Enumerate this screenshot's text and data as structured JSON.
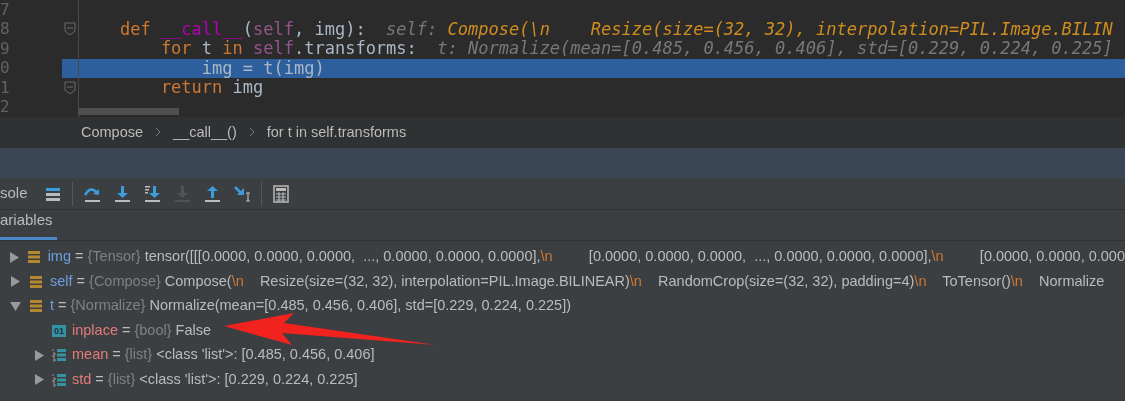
{
  "editor": {
    "lines": [
      {
        "number": "7",
        "current": false,
        "fold": false
      },
      {
        "number": "8",
        "current": false,
        "fold": true,
        "segments": [
          {
            "kind": "keyword",
            "text": "    def "
          },
          {
            "kind": "function",
            "text": "__call__"
          },
          {
            "kind": "plain",
            "text": "("
          },
          {
            "kind": "self",
            "text": "self"
          },
          {
            "kind": "plain",
            "text": ", img):  "
          },
          {
            "kind": "hint",
            "text": "self: "
          },
          {
            "kind": "hint_value",
            "text": "Compose(\\n    Resize(size=(32, 32), interpolation=PIL.Image.BILIN"
          }
        ]
      },
      {
        "number": "9",
        "current": false,
        "fold": false,
        "segments": [
          {
            "kind": "keyword",
            "text": "        for "
          },
          {
            "kind": "plain",
            "text": "t "
          },
          {
            "kind": "keyword",
            "text": "in "
          },
          {
            "kind": "self",
            "text": "self"
          },
          {
            "kind": "plain",
            "text": ".transforms:  "
          },
          {
            "kind": "hint",
            "text": "t: Normalize(mean=[0.485, 0.456, 0.406], std=[0.229, 0.224, 0.225]"
          }
        ]
      },
      {
        "number": "0",
        "current": true,
        "fold": false,
        "segments": [
          {
            "kind": "plain",
            "text": "            img = t(img)"
          }
        ]
      },
      {
        "number": "1",
        "current": false,
        "fold": true,
        "segments": [
          {
            "kind": "keyword",
            "text": "        return "
          },
          {
            "kind": "plain",
            "text": "img"
          }
        ]
      },
      {
        "number": "2",
        "current": false,
        "fold": false
      }
    ]
  },
  "breadcrumbs": [
    "Compose",
    "__call__()",
    "for t in self.transforms"
  ],
  "toolbar": {
    "label": "sole",
    "tools": [
      {
        "kind": "layout",
        "disabled": false
      },
      {
        "kind": "step_over",
        "disabled": false
      },
      {
        "kind": "step_into",
        "disabled": false
      },
      {
        "kind": "step_into_my_code",
        "disabled": false
      },
      {
        "kind": "force_step_into",
        "disabled": true
      },
      {
        "kind": "step_out",
        "disabled": false
      },
      {
        "kind": "run_to_cursor",
        "disabled": false
      },
      {
        "kind": "evaluate",
        "disabled": false
      }
    ]
  },
  "tabs": [
    {
      "label": "ariables",
      "selected": true
    }
  ],
  "variables": [
    {
      "kind": "object",
      "name": "img",
      "operator": "=",
      "type": "{Tensor}",
      "expanded": false,
      "value": [
        {
          "kind": "text",
          "text": "tensor([[[0.0000, 0.0000, 0.0000,  ..., 0.0000, 0.0000, 0.0000],"
        },
        {
          "kind": "escape",
          "text": "\\n"
        },
        {
          "kind": "text",
          "text": "         [0.0000, 0.0000, 0.0000,  ..., 0.0000, 0.0000, 0.0000],"
        },
        {
          "kind": "escape",
          "text": "\\n"
        },
        {
          "kind": "text",
          "text": "         [0.0000, 0.0000, 0.000"
        }
      ]
    },
    {
      "kind": "object",
      "name": "self",
      "operator": "=",
      "type": "{Compose}",
      "expanded": false,
      "value": [
        {
          "kind": "text",
          "text": "Compose("
        },
        {
          "kind": "escape",
          "text": "\\n"
        },
        {
          "kind": "text",
          "text": "    Resize(size=(32, 32), interpolation=PIL.Image.BILINEAR)"
        },
        {
          "kind": "escape",
          "text": "\\n"
        },
        {
          "kind": "text",
          "text": "    RandomCrop(size=(32, 32), padding=4)"
        },
        {
          "kind": "escape",
          "text": "\\n"
        },
        {
          "kind": "text",
          "text": "    ToTensor()"
        },
        {
          "kind": "escape",
          "text": "\\n"
        },
        {
          "kind": "text",
          "text": "    Normalize"
        }
      ]
    },
    {
      "kind": "object",
      "name": "t",
      "operator": "=",
      "type": "{Normalize}",
      "expanded": true,
      "value": [
        {
          "kind": "text",
          "text": "Normalize(mean=[0.485, 0.456, 0.406], std=[0.229, 0.224, 0.225])"
        }
      ],
      "children": [
        {
          "kind": "bool",
          "badge": "01",
          "name": "inplace",
          "operator": "=",
          "type": "{bool}",
          "value": [
            {
              "kind": "text",
              "text": "False"
            }
          ]
        },
        {
          "kind": "list",
          "name": "mean",
          "operator": "=",
          "type": "{list}",
          "expanded": false,
          "value": [
            {
              "kind": "text",
              "text": "<class 'list'>: [0.485, 0.456, 0.406]"
            }
          ]
        },
        {
          "kind": "list",
          "name": "std",
          "operator": "=",
          "type": "{list}",
          "expanded": false,
          "value": [
            {
              "kind": "text",
              "text": "<class 'list'>: [0.229, 0.224, 0.225]"
            }
          ]
        }
      ]
    }
  ]
}
